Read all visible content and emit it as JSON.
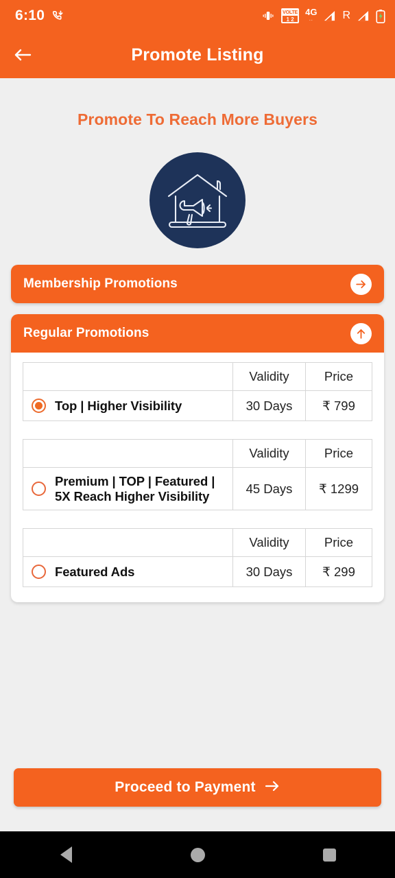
{
  "statusbar": {
    "time": "6:10",
    "call_icon": "missed-call-icon",
    "vibrate_icon": "vibrate-icon",
    "volte_label": "VOLTE",
    "volte_sims": "1 2",
    "network": "4G",
    "network_sub": "..",
    "roaming": "R",
    "battery_icon": "battery-charging-icon"
  },
  "appbar": {
    "title": "Promote Listing",
    "back_icon": "back-arrow-icon"
  },
  "page": {
    "heading": "Promote To Reach More Buyers",
    "logo_icon": "house-megaphone-icon"
  },
  "sections": {
    "membership": {
      "title": "Membership Promotions",
      "arrow_icon": "arrow-right-circle-icon",
      "expanded": false
    },
    "regular": {
      "title": "Regular Promotions",
      "arrow_icon": "arrow-up-circle-icon",
      "expanded": true
    }
  },
  "table_headers": {
    "name": "",
    "validity": "Validity",
    "price": "Price"
  },
  "plans": [
    {
      "label": "Top | Higher Visibility",
      "label_line1": "Top | Higher Visibility",
      "label_line2": "",
      "validity": "30 Days",
      "price": "₹ 799",
      "selected": true
    },
    {
      "label": "Premium | TOP | Featured | 5X Reach Higher Visibility",
      "label_line1": "Premium | TOP | Featured |",
      "label_line2": "5X Reach Higher Visibility",
      "validity": "45 Days",
      "price": "₹ 1299",
      "selected": false
    },
    {
      "label": "Featured Ads",
      "label_line1": "Featured Ads",
      "label_line2": "",
      "validity": "30 Days",
      "price": "₹ 299",
      "selected": false
    }
  ],
  "proceed": {
    "label": "Proceed to Payment",
    "arrow_icon": "arrow-right-icon"
  },
  "navbar": {
    "back": "back-triangle-icon",
    "home": "home-circle-icon",
    "recents": "recents-square-icon"
  },
  "colors": {
    "brand_orange": "#F4621F",
    "heading_orange": "#EE6B35",
    "logo_navy": "#1E3359",
    "page_bg": "#EFEFEF",
    "card_white": "#FFFFFF",
    "radio_orange": "#EF6A23"
  }
}
